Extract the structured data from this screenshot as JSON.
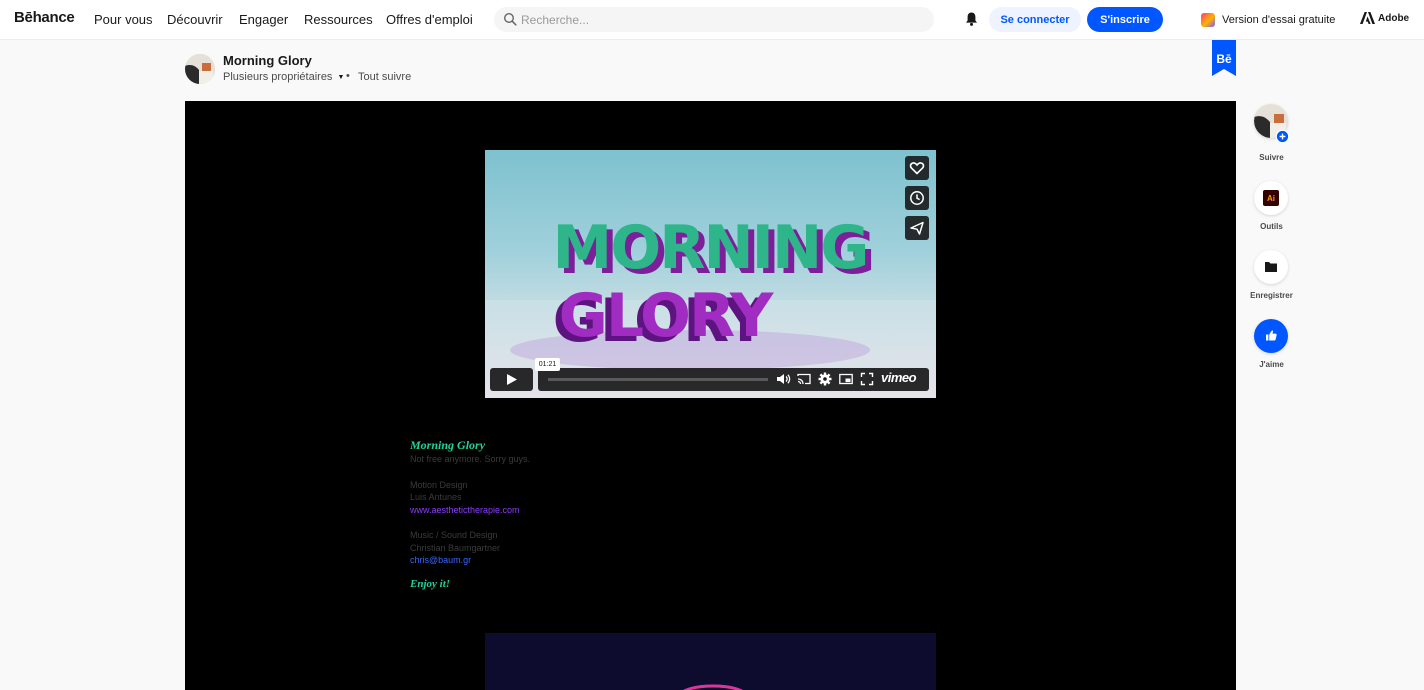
{
  "nav": {
    "logo": "Bēhance",
    "links": [
      "Pour vous",
      "Découvrir",
      "Engager",
      "Ressources",
      "Offres d'emploi"
    ],
    "search_placeholder": "Recherche...",
    "login": "Se connecter",
    "signup": "S'inscrire",
    "trial": "Version d'essai gratuite",
    "adobe": "Adobe"
  },
  "project": {
    "title": "Morning Glory",
    "owners": "Plusieurs propriétaires",
    "separator": "•",
    "follow_all": "Tout suivre",
    "ribbon": "Bē"
  },
  "video": {
    "timecode": "01:21",
    "progress": 0.0,
    "brand": "vimeo",
    "side_buttons": [
      "heart-icon",
      "clock-icon",
      "share-icon"
    ],
    "title_lines": [
      "MORNING",
      "GLORY"
    ]
  },
  "description": {
    "title": "Morning Glory",
    "subtitle": "Not free anymore. Sorry guys.",
    "section1": [
      "Motion Design",
      "Luis Antunes"
    ],
    "link1": "www.aesthetictherapie.com",
    "section2": [
      "Music / Sound Design",
      "Christian Baumgartner"
    ],
    "link2": "chris@baum.gr",
    "closing": "Enjoy it!"
  },
  "rail": {
    "follow": "Suivre",
    "tools": "Outils",
    "tools_badge": "Ai",
    "save": "Enregistrer",
    "like": "J'aime"
  },
  "colors": {
    "accent": "#0057ff",
    "description_green": "#1fd39b",
    "link_purple": "#8b3dff"
  }
}
